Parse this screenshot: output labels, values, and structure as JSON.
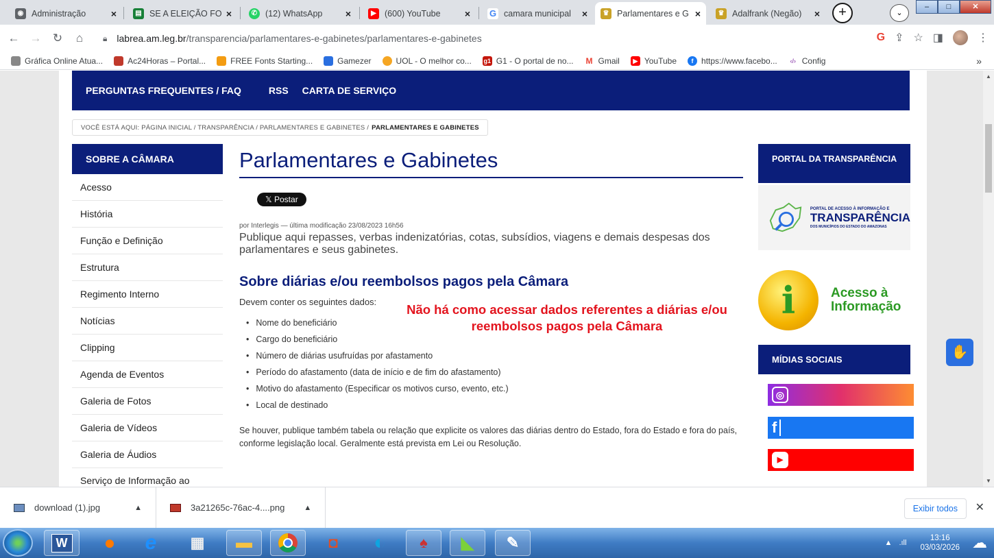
{
  "browser": {
    "tabs": [
      {
        "title": "Administração",
        "icon": "globe-icon",
        "color": "#5f6368"
      },
      {
        "title": "SE A ELEIÇÃO FOS",
        "icon": "sheets-icon",
        "color": "#188038"
      },
      {
        "title": "(12) WhatsApp",
        "icon": "whatsapp-icon",
        "color": "#25d366"
      },
      {
        "title": "(600) YouTube",
        "icon": "youtube-icon",
        "color": "#ff0000"
      },
      {
        "title": "camara municipal",
        "icon": "google-icon",
        "color": "#4285f4"
      },
      {
        "title": "Parlamentares e G",
        "icon": "crest-icon",
        "color": "#c9a227"
      },
      {
        "title": "Adalfrank (Negão)",
        "icon": "crest-icon",
        "color": "#c9a227"
      }
    ],
    "url_host": "labrea.am.leg.br",
    "url_path": "/transparencia/parlamentares-e-gabinetes/parlamentares-e-gabinetes",
    "bookmarks": [
      {
        "label": "Gráfica Online Atua...",
        "color": "#888888"
      },
      {
        "label": "Ac24Horas – Portal...",
        "color": "#c0392b"
      },
      {
        "label": "FREE Fonts Starting...",
        "color": "#f39c12"
      },
      {
        "label": "Gamezer",
        "color": "#2a6fe0"
      },
      {
        "label": "UOL - O melhor co...",
        "color": "#f5a623"
      },
      {
        "label": "G1 - O portal de no...",
        "color": "#c4170c"
      },
      {
        "label": "Gmail",
        "color": "#ea4335"
      },
      {
        "label": "YouTube",
        "color": "#ff0000"
      },
      {
        "label": "https://www.facebo...",
        "color": "#1877f2"
      },
      {
        "label": "Config",
        "color": "#9b59b6"
      }
    ]
  },
  "site": {
    "topnav": [
      "PERGUNTAS FREQUENTES / FAQ",
      "RSS",
      "CARTA DE SERVIÇO"
    ],
    "breadcrumb_prefix": "VOCÊ ESTÁ AQUI: PÁGINA INICIAL / TRANSPARÊNCIA / PARLAMENTARES E GABINETES /",
    "breadcrumb_current": "PARLAMENTARES E GABINETES",
    "sidebar_title": "SOBRE A CÂMARA",
    "sidebar_items": [
      "Acesso",
      "História",
      "Função e Definição",
      "Estrutura",
      "Regimento Interno",
      "Notícias",
      "Clipping",
      "Agenda de Eventos",
      "Galeria de Fotos",
      "Galeria de Vídeos",
      "Galeria de Áudios",
      "Serviço de Informação ao"
    ],
    "page_title": "Parlamentares e Gabinetes",
    "post_button": "𝕏 Postar",
    "byline": "por Interlegis — última modificação 23/08/2023 16h56",
    "description": "Publique aqui repasses, verbas indenizatórias, cotas, subsídios, viagens e demais despesas dos parlamentares e seus gabinetes.",
    "section_title": "Sobre diárias e/ou reembolsos pagos pela Câmara",
    "section_intro": "Devem conter os seguintes dados:",
    "bullets": [
      "Nome do beneficiário",
      "Cargo do beneficiário",
      "Número de diárias usufruídas por afastamento",
      "Período do afastamento (data de início e de fim do afastamento)",
      "Motivo do afastamento (Especificar os motivos curso, evento, etc.)",
      "Local de destinado"
    ],
    "footer_text": "Se houver, publique também tabela ou relação que explicite os valores das diárias dentro do Estado, fora do Estado e fora do país, conforme legislação local. Geralmente está prevista em Lei ou Resolução.",
    "overlay_message": "Não há como acessar dados referentes a diárias e/ou reembolsos pagos pela Câmara",
    "right_title": "PORTAL DA TRANSPARÊNCIA",
    "portal_small": "PORTAL DE ACESSO À INFORMAÇÃO E",
    "portal_big": "TRANSPARÊNCIA",
    "portal_sub": "DOS MUNICÍPIOS DO ESTADO DO AMAZONAS",
    "acesso_line1": "Acesso à",
    "acesso_line2": "Informação",
    "midias_title": "MÍDIAS SOCIAIS"
  },
  "downloads": {
    "files": [
      "download (1).jpg",
      "3a21265c-76ac-4....png"
    ],
    "show_all": "Exibir todos"
  },
  "taskbar": {
    "time": "13:16",
    "date": "03/03/2026"
  }
}
